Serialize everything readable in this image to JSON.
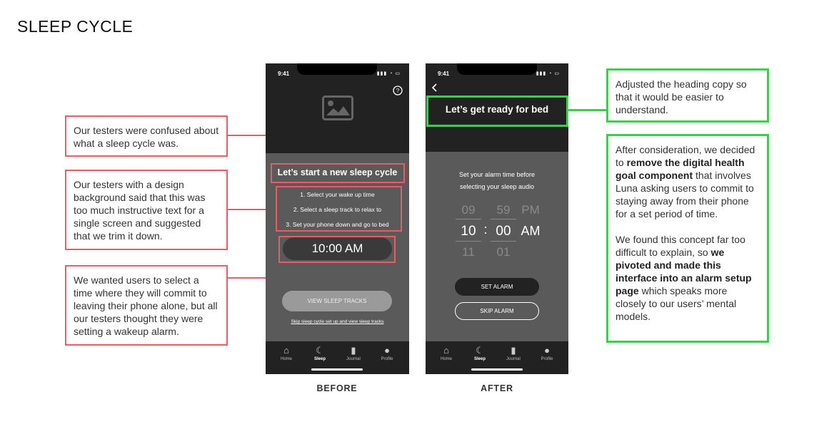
{
  "title": "SLEEP CYCLE",
  "before": {
    "caption": "BEFORE",
    "status_time": "9:41",
    "heading": "Let’s start a new sleep cycle",
    "steps": [
      "1. Select your wake up time",
      "2. Select a sleep track to relax to",
      "3. Set your phone down and go to bed"
    ],
    "time_pill": "10:00 AM",
    "view_tracks": "VIEW SLEEP TRACKS",
    "skip_link": "Skip sleep cycle set up and view sleep tracks"
  },
  "after": {
    "caption": "AFTER",
    "status_time": "9:41",
    "heading": "Let’s get ready for bed",
    "instruction_1": "Set your alarm time before",
    "instruction_2": "selecting your sleep audio",
    "picker": {
      "hours": [
        "09",
        "10",
        "11"
      ],
      "minutes": [
        "59",
        "00",
        "01"
      ],
      "periods": [
        "PM",
        "AM"
      ],
      "separator": ":"
    },
    "set_alarm": "SET ALARM",
    "skip_alarm": "SKIP ALARM"
  },
  "tabs": [
    "Home",
    "Sleep",
    "Journal",
    "Profile"
  ],
  "notes": {
    "red_1": "Our testers were confused about what a sleep cycle was.",
    "red_2": "Our testers with a design background said that this was too much instructive text for a single screen and suggested that we trim it down.",
    "red_3": "We wanted users to select a time where they will commit to leaving their phone alone, but all our testers thought they were setting a wakeup alarm.",
    "green_1": "Adjusted the heading copy so that it would be easier to understand.",
    "green_2": {
      "p1_a": "After consideration, we decided to ",
      "p1_b": "remove the digital health goal component",
      "p1_c": " that involves Luna asking users to commit to staying away from their phone for a set period of time.",
      "p2_a": "We found this concept far too difficult to explain, so ",
      "p2_b": "we pivoted and made this interface into an alarm setup page",
      "p2_c": " which speaks more closely to our users’ mental models."
    }
  },
  "colors": {
    "red": "#e0606a",
    "green": "#3ccf4e",
    "phone_dark": "#222222",
    "phone_body": "#5a5a5a"
  }
}
